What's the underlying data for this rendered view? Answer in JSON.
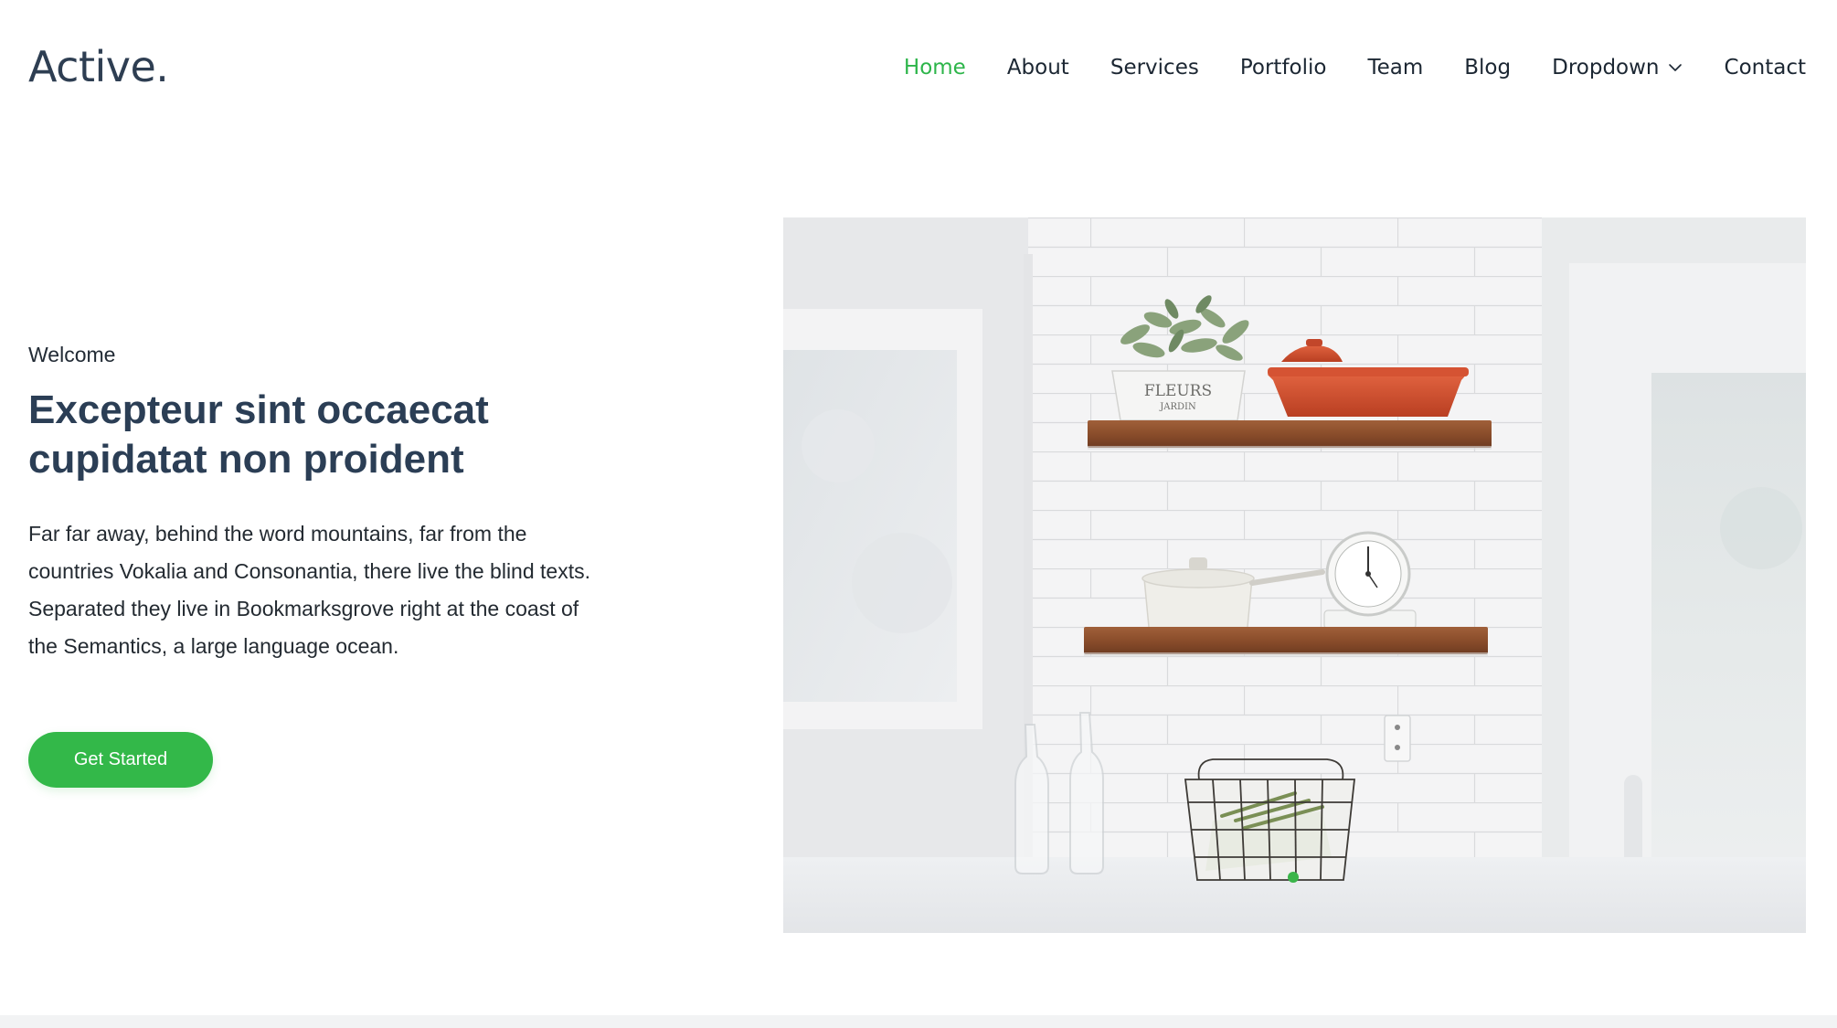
{
  "brand": {
    "name": "Active."
  },
  "nav": {
    "items": [
      {
        "label": "Home"
      },
      {
        "label": "About"
      },
      {
        "label": "Services"
      },
      {
        "label": "Portfolio"
      },
      {
        "label": "Team"
      },
      {
        "label": "Blog"
      },
      {
        "label": "Dropdown"
      },
      {
        "label": "Contact"
      }
    ],
    "active": "Home",
    "dropdown_icon": "chevron-down-icon"
  },
  "hero": {
    "eyebrow": "Welcome",
    "title": "Excepteur sint occaecat cupidatat non proident",
    "text": "Far far away, behind the word mountains, far from the countries Vokalia and Consonantia, there live the blind texts. Separated they live in Bookmarksgrove right at the coast of the Semantics, a large language ocean.",
    "cta_label": "Get Started",
    "image_alt": "Kitchen shelves with plant pot, red dish, saucepan, scale and wire basket",
    "image_text": {
      "pot_line1": "FLEURS",
      "pot_line2": "JARDIN"
    }
  },
  "colors": {
    "accent": "#33b849",
    "nav_active": "#2db54a",
    "heading": "#2b3e55",
    "text": "#232a31",
    "background": "#ffffff"
  }
}
